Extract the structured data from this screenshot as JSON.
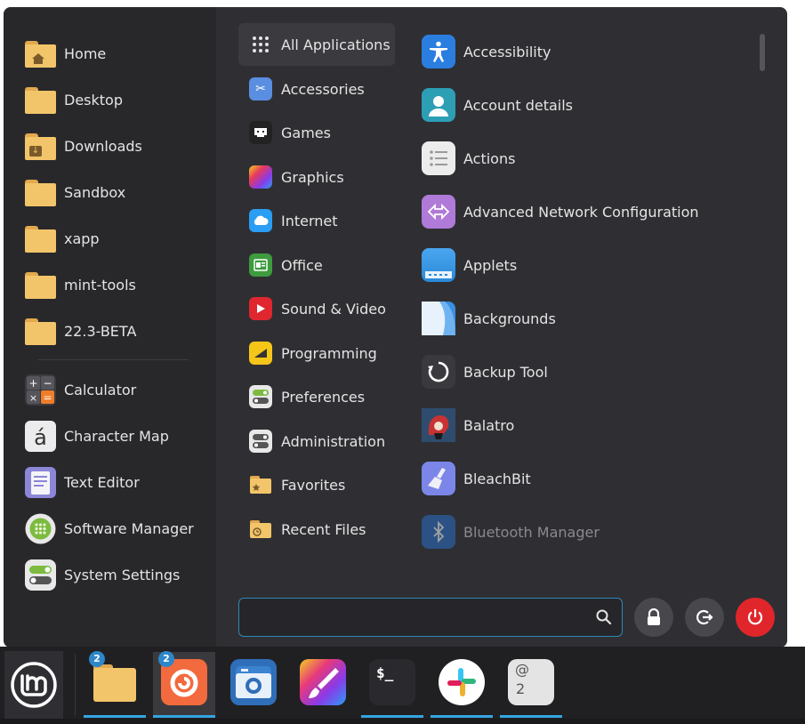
{
  "places": [
    {
      "label": "Home",
      "icon": "home-folder-icon"
    },
    {
      "label": "Desktop",
      "icon": "folder-icon"
    },
    {
      "label": "Downloads",
      "icon": "downloads-folder-icon"
    },
    {
      "label": "Sandbox",
      "icon": "folder-icon"
    },
    {
      "label": "xapp",
      "icon": "folder-icon"
    },
    {
      "label": "mint-tools",
      "icon": "folder-icon"
    },
    {
      "label": "22.3-BETA",
      "icon": "folder-icon"
    }
  ],
  "favorites": [
    {
      "label": "Calculator",
      "icon": "calculator-icon"
    },
    {
      "label": "Character Map",
      "icon": "character-map-icon"
    },
    {
      "label": "Text Editor",
      "icon": "text-editor-icon"
    },
    {
      "label": "Software Manager",
      "icon": "software-manager-icon"
    },
    {
      "label": "System Settings",
      "icon": "system-settings-icon"
    }
  ],
  "categories": [
    {
      "label": "All Applications",
      "icon": "grid-icon",
      "active": true
    },
    {
      "label": "Accessories",
      "icon": "accessories-icon"
    },
    {
      "label": "Games",
      "icon": "games-icon"
    },
    {
      "label": "Graphics",
      "icon": "graphics-icon"
    },
    {
      "label": "Internet",
      "icon": "internet-icon"
    },
    {
      "label": "Office",
      "icon": "office-icon"
    },
    {
      "label": "Sound & Video",
      "icon": "sound-video-icon"
    },
    {
      "label": "Programming",
      "icon": "programming-icon"
    },
    {
      "label": "Preferences",
      "icon": "preferences-icon"
    },
    {
      "label": "Administration",
      "icon": "administration-icon"
    },
    {
      "label": "Favorites",
      "icon": "favorites-folder-icon"
    },
    {
      "label": "Recent Files",
      "icon": "recent-files-icon"
    }
  ],
  "apps": [
    {
      "label": "Accessibility",
      "icon": "accessibility-icon"
    },
    {
      "label": "Account details",
      "icon": "account-details-icon"
    },
    {
      "label": "Actions",
      "icon": "actions-icon"
    },
    {
      "label": "Advanced Network Configuration",
      "icon": "network-config-icon"
    },
    {
      "label": "Applets",
      "icon": "applets-icon"
    },
    {
      "label": "Backgrounds",
      "icon": "backgrounds-icon"
    },
    {
      "label": "Backup Tool",
      "icon": "backup-tool-icon"
    },
    {
      "label": "Balatro",
      "icon": "balatro-icon"
    },
    {
      "label": "BleachBit",
      "icon": "bleachbit-icon"
    },
    {
      "label": "Bluetooth Manager",
      "icon": "bluetooth-icon"
    }
  ],
  "search": {
    "value": "",
    "placeholder": ""
  },
  "buttons": {
    "lock": "lock-icon",
    "logout": "logout-icon",
    "power": "power-icon"
  },
  "taskbar": {
    "items": [
      {
        "name": "files",
        "icon": "folder-icon",
        "count": "2"
      },
      {
        "name": "firefox",
        "icon": "firefox-icon",
        "count": "2"
      },
      {
        "name": "screenshot",
        "icon": "camera-icon"
      },
      {
        "name": "drawing",
        "icon": "paint-brush-icon"
      },
      {
        "name": "terminal",
        "icon": "terminal-icon",
        "text": "$_"
      },
      {
        "name": "slack",
        "icon": "slack-icon"
      },
      {
        "name": "mail",
        "icon": "at-icon",
        "text": "@",
        "sub": "2"
      }
    ]
  },
  "colors": {
    "accent": "#35a5e2",
    "power": "#e1262b",
    "folder": "#f2c56a"
  }
}
